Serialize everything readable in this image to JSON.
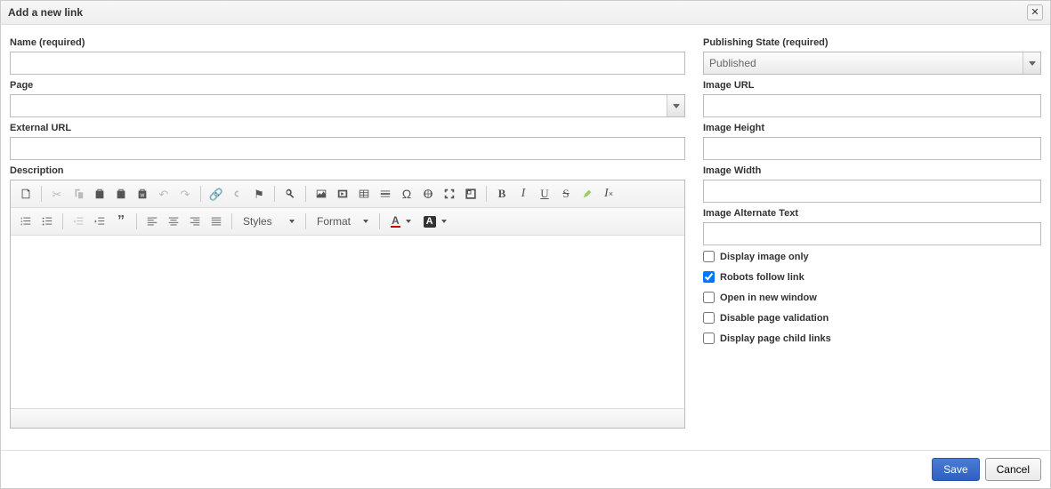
{
  "dialog": {
    "title": "Add a new link"
  },
  "left": {
    "name_label": "Name (required)",
    "name_value": "",
    "page_label": "Page",
    "page_value": "",
    "exturl_label": "External URL",
    "exturl_value": "",
    "description_label": "Description"
  },
  "right": {
    "pubstate_label": "Publishing State (required)",
    "pubstate_value": "Published",
    "imgurl_label": "Image URL",
    "imgurl_value": "",
    "imgheight_label": "Image Height",
    "imgheight_value": "",
    "imgwidth_label": "Image Width",
    "imgwidth_value": "",
    "imgalt_label": "Image Alternate Text",
    "imgalt_value": "",
    "chk_display_image_only": "Display image only",
    "chk_robots_follow": "Robots follow link",
    "chk_open_new_window": "Open in new window",
    "chk_disable_page_validation": "Disable page validation",
    "chk_display_child_links": "Display page child links"
  },
  "toolbar": {
    "styles_label": "Styles",
    "format_label": "Format"
  },
  "footer": {
    "save": "Save",
    "cancel": "Cancel"
  }
}
